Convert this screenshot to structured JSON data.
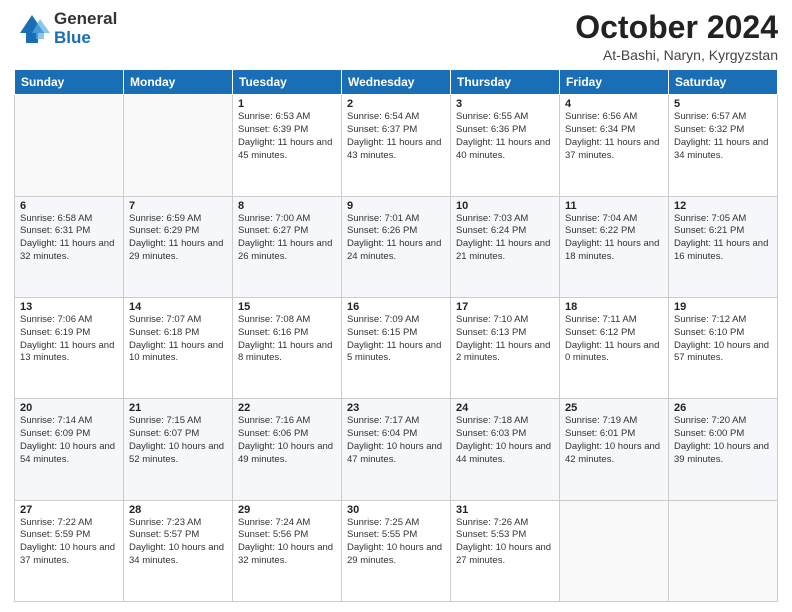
{
  "logo": {
    "general": "General",
    "blue": "Blue"
  },
  "header": {
    "month": "October 2024",
    "location": "At-Bashi, Naryn, Kyrgyzstan"
  },
  "weekdays": [
    "Sunday",
    "Monday",
    "Tuesday",
    "Wednesday",
    "Thursday",
    "Friday",
    "Saturday"
  ],
  "weeks": [
    [
      {
        "day": "",
        "info": ""
      },
      {
        "day": "",
        "info": ""
      },
      {
        "day": "1",
        "info": "Sunrise: 6:53 AM\nSunset: 6:39 PM\nDaylight: 11 hours and 45 minutes."
      },
      {
        "day": "2",
        "info": "Sunrise: 6:54 AM\nSunset: 6:37 PM\nDaylight: 11 hours and 43 minutes."
      },
      {
        "day": "3",
        "info": "Sunrise: 6:55 AM\nSunset: 6:36 PM\nDaylight: 11 hours and 40 minutes."
      },
      {
        "day": "4",
        "info": "Sunrise: 6:56 AM\nSunset: 6:34 PM\nDaylight: 11 hours and 37 minutes."
      },
      {
        "day": "5",
        "info": "Sunrise: 6:57 AM\nSunset: 6:32 PM\nDaylight: 11 hours and 34 minutes."
      }
    ],
    [
      {
        "day": "6",
        "info": "Sunrise: 6:58 AM\nSunset: 6:31 PM\nDaylight: 11 hours and 32 minutes."
      },
      {
        "day": "7",
        "info": "Sunrise: 6:59 AM\nSunset: 6:29 PM\nDaylight: 11 hours and 29 minutes."
      },
      {
        "day": "8",
        "info": "Sunrise: 7:00 AM\nSunset: 6:27 PM\nDaylight: 11 hours and 26 minutes."
      },
      {
        "day": "9",
        "info": "Sunrise: 7:01 AM\nSunset: 6:26 PM\nDaylight: 11 hours and 24 minutes."
      },
      {
        "day": "10",
        "info": "Sunrise: 7:03 AM\nSunset: 6:24 PM\nDaylight: 11 hours and 21 minutes."
      },
      {
        "day": "11",
        "info": "Sunrise: 7:04 AM\nSunset: 6:22 PM\nDaylight: 11 hours and 18 minutes."
      },
      {
        "day": "12",
        "info": "Sunrise: 7:05 AM\nSunset: 6:21 PM\nDaylight: 11 hours and 16 minutes."
      }
    ],
    [
      {
        "day": "13",
        "info": "Sunrise: 7:06 AM\nSunset: 6:19 PM\nDaylight: 11 hours and 13 minutes."
      },
      {
        "day": "14",
        "info": "Sunrise: 7:07 AM\nSunset: 6:18 PM\nDaylight: 11 hours and 10 minutes."
      },
      {
        "day": "15",
        "info": "Sunrise: 7:08 AM\nSunset: 6:16 PM\nDaylight: 11 hours and 8 minutes."
      },
      {
        "day": "16",
        "info": "Sunrise: 7:09 AM\nSunset: 6:15 PM\nDaylight: 11 hours and 5 minutes."
      },
      {
        "day": "17",
        "info": "Sunrise: 7:10 AM\nSunset: 6:13 PM\nDaylight: 11 hours and 2 minutes."
      },
      {
        "day": "18",
        "info": "Sunrise: 7:11 AM\nSunset: 6:12 PM\nDaylight: 11 hours and 0 minutes."
      },
      {
        "day": "19",
        "info": "Sunrise: 7:12 AM\nSunset: 6:10 PM\nDaylight: 10 hours and 57 minutes."
      }
    ],
    [
      {
        "day": "20",
        "info": "Sunrise: 7:14 AM\nSunset: 6:09 PM\nDaylight: 10 hours and 54 minutes."
      },
      {
        "day": "21",
        "info": "Sunrise: 7:15 AM\nSunset: 6:07 PM\nDaylight: 10 hours and 52 minutes."
      },
      {
        "day": "22",
        "info": "Sunrise: 7:16 AM\nSunset: 6:06 PM\nDaylight: 10 hours and 49 minutes."
      },
      {
        "day": "23",
        "info": "Sunrise: 7:17 AM\nSunset: 6:04 PM\nDaylight: 10 hours and 47 minutes."
      },
      {
        "day": "24",
        "info": "Sunrise: 7:18 AM\nSunset: 6:03 PM\nDaylight: 10 hours and 44 minutes."
      },
      {
        "day": "25",
        "info": "Sunrise: 7:19 AM\nSunset: 6:01 PM\nDaylight: 10 hours and 42 minutes."
      },
      {
        "day": "26",
        "info": "Sunrise: 7:20 AM\nSunset: 6:00 PM\nDaylight: 10 hours and 39 minutes."
      }
    ],
    [
      {
        "day": "27",
        "info": "Sunrise: 7:22 AM\nSunset: 5:59 PM\nDaylight: 10 hours and 37 minutes."
      },
      {
        "day": "28",
        "info": "Sunrise: 7:23 AM\nSunset: 5:57 PM\nDaylight: 10 hours and 34 minutes."
      },
      {
        "day": "29",
        "info": "Sunrise: 7:24 AM\nSunset: 5:56 PM\nDaylight: 10 hours and 32 minutes."
      },
      {
        "day": "30",
        "info": "Sunrise: 7:25 AM\nSunset: 5:55 PM\nDaylight: 10 hours and 29 minutes."
      },
      {
        "day": "31",
        "info": "Sunrise: 7:26 AM\nSunset: 5:53 PM\nDaylight: 10 hours and 27 minutes."
      },
      {
        "day": "",
        "info": ""
      },
      {
        "day": "",
        "info": ""
      }
    ]
  ]
}
